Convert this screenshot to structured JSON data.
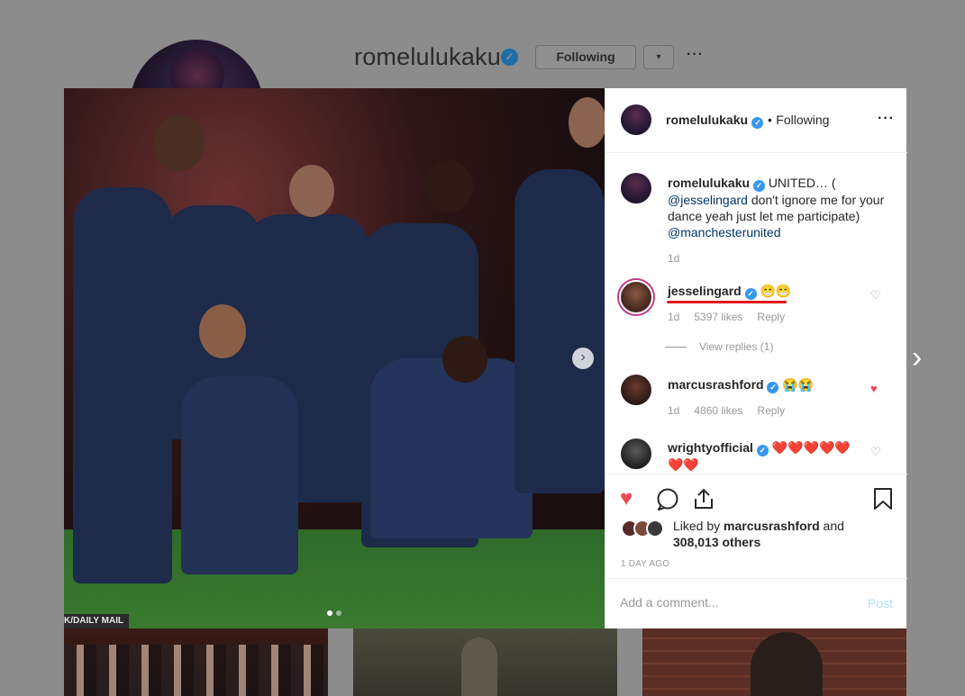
{
  "profile": {
    "username": "romelulukaku",
    "following_label": "Following",
    "dropdown_glyph": "▾",
    "more_glyph": "···"
  },
  "photo": {
    "credit": "K/DAILY MAIL",
    "next_glyph": "›"
  },
  "post": {
    "author": "romelulukaku",
    "separator": "•",
    "follow_state": "Following",
    "more_glyph": "···",
    "caption": {
      "author": "romelulukaku",
      "text_1": "UNITED… (",
      "mention_1": "@jesselingard",
      "text_2": "don't ignore me for your dance yeah just let me participate)",
      "mention_2": "@manchesterunited",
      "time": "1d"
    },
    "comments": [
      {
        "user": "jesselingard",
        "text": "😁😁",
        "time": "1d",
        "likes": "5397 likes",
        "reply": "Reply",
        "liked": false
      },
      {
        "user": "marcusrashford",
        "text": "😭😭",
        "time": "1d",
        "likes": "4860 likes",
        "reply": "Reply",
        "liked": true
      },
      {
        "user": "wrightyofficial",
        "text": "❤️❤️❤️❤️❤️❤️❤️",
        "liked": false
      }
    ],
    "view_replies": "View replies (1)",
    "liked_by_prefix": "Liked by",
    "liked_by_user": "marcusrashford",
    "liked_by_and": "and",
    "liked_by_others": "308,013 others",
    "timestamp": "1 DAY AGO",
    "comment_placeholder": "Add a comment...",
    "post_label": "Post"
  },
  "page_next_glyph": "›",
  "colors": {
    "like_red": "#ed4956",
    "verified_blue": "#3897f0",
    "annotation_red": "#e21b1b"
  }
}
